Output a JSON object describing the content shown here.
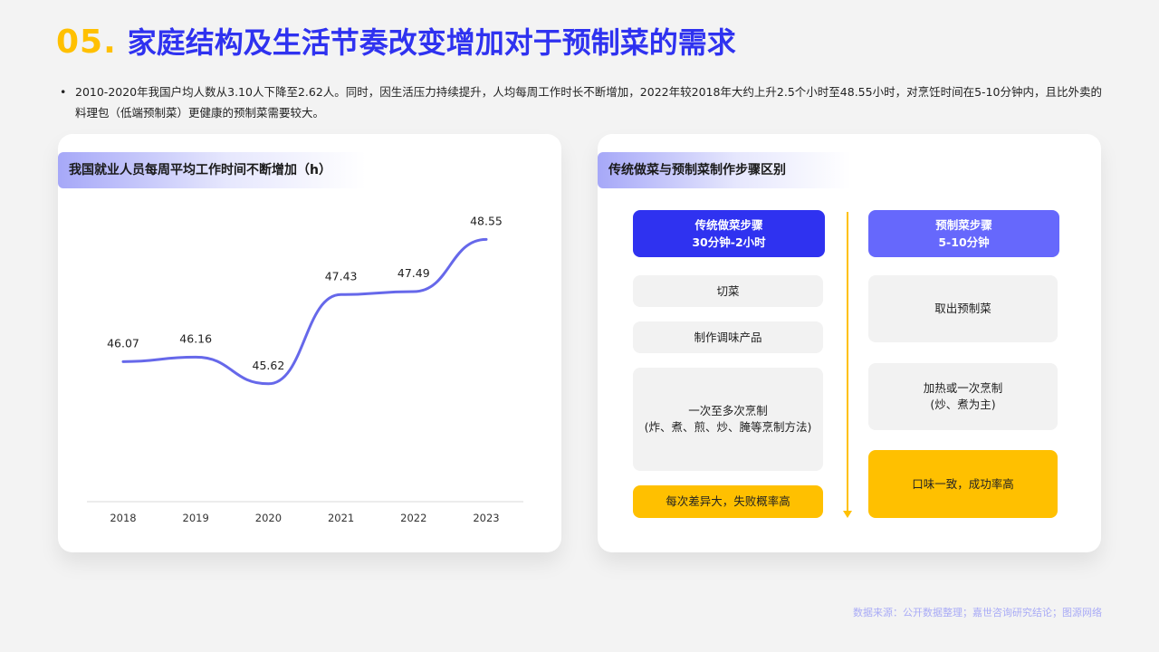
{
  "header": {
    "number": "05.",
    "title": "家庭结构及生活节奏改变增加对于预制菜的需求"
  },
  "intro": {
    "bullet": "•",
    "text": "2010-2020年我国户均人数从3.10人下降至2.62人。同时，因生活压力持续提升，人均每周工作时长不断增加，2022年较2018年大约上升2.5个小时至48.55小时，对烹饪时间在5-10分钟内，且比外卖的料理包（低端预制菜）更健康的预制菜需要较大。"
  },
  "left_card": {
    "title": "我国就业人员每周平均工作时间不断增加（h）"
  },
  "chart_data": {
    "type": "line",
    "title": "我国就业人员每周平均工作时间不断增加（h）",
    "categories": [
      "2018",
      "2019",
      "2020",
      "2021",
      "2022",
      "2023"
    ],
    "series": [
      {
        "values": [
          46.07,
          46.16,
          45.62,
          47.43,
          47.49,
          48.55
        ]
      }
    ],
    "value_labels": [
      "46.07",
      "46.16",
      "45.62",
      "47.43",
      "47.49",
      "48.55"
    ],
    "xlabel": "",
    "ylabel": "",
    "ylim": [
      44.9,
      48.85
    ],
    "grid": false,
    "line_color": "#6668ea",
    "smooth": true
  },
  "right_card": {
    "title": "传统做菜与预制菜制作步骤区别",
    "traditional": {
      "header_line1": "传统做菜步骤",
      "header_line2": "30分钟-2小时",
      "steps": [
        {
          "lines": [
            "切菜"
          ]
        },
        {
          "lines": [
            "制作调味产品"
          ]
        },
        {
          "lines": [
            "一次至多次烹制",
            "(炸、煮、煎、炒、腌等烹制方法)"
          ]
        }
      ],
      "result": "每次差异大，失败概率高"
    },
    "prepared": {
      "header_line1": "预制菜步骤",
      "header_line2": "5-10分钟",
      "steps": [
        {
          "lines": [
            "取出预制菜"
          ]
        },
        {
          "lines": [
            "加热或一次烹制",
            "(炒、煮为主)"
          ]
        }
      ],
      "result": "口味一致，成功率高"
    }
  },
  "source": "数据来源：公开数据整理；嘉世咨询研究结论；图源网络",
  "colors": {
    "accent_blue": "#2f32f0",
    "accent_purple": "#6668fc",
    "accent_yellow": "#ffc000"
  }
}
